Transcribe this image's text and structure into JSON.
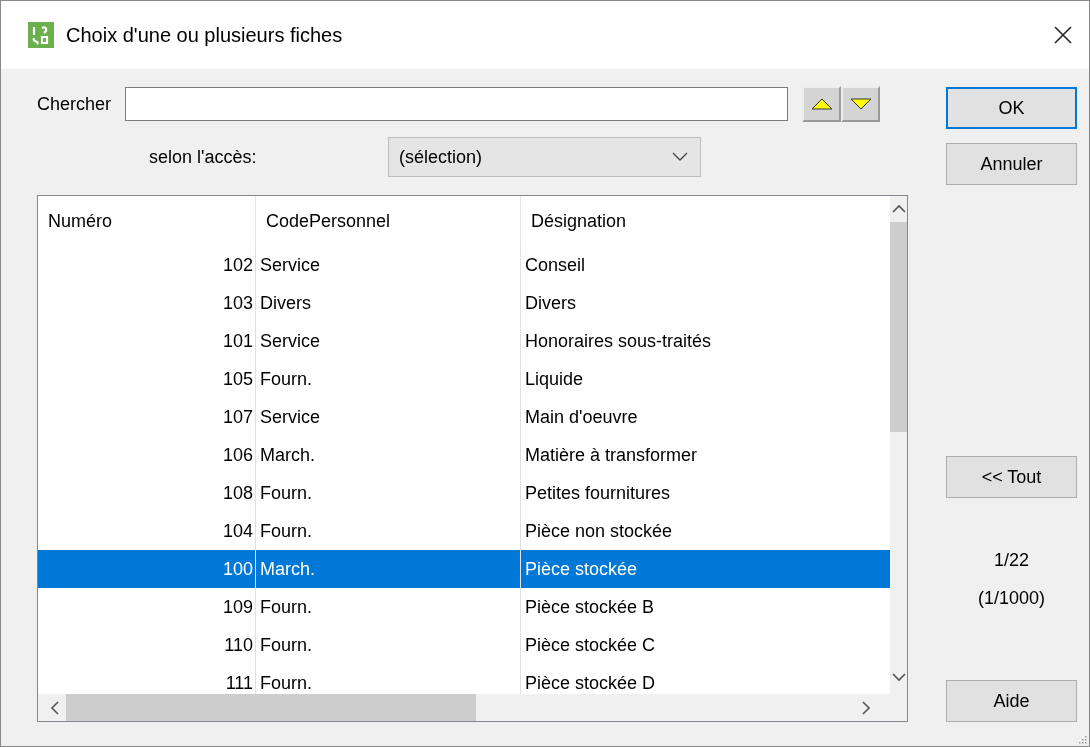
{
  "window": {
    "title": "Choix d'une ou plusieurs fiches"
  },
  "search": {
    "label": "Chercher"
  },
  "access": {
    "label": "selon l'accès:",
    "value": "(sélection)"
  },
  "table": {
    "columns": [
      "Numéro",
      "CodePersonnel",
      "Désignation"
    ],
    "rows": [
      {
        "cells": [
          "102",
          "Service",
          "Conseil"
        ],
        "selected": false
      },
      {
        "cells": [
          "103",
          "Divers",
          "Divers"
        ],
        "selected": false
      },
      {
        "cells": [
          "101",
          "Service",
          "Honoraires sous-traités"
        ],
        "selected": false
      },
      {
        "cells": [
          "105",
          "Fourn.",
          "Liquide"
        ],
        "selected": false
      },
      {
        "cells": [
          "107",
          "Service",
          "Main d'oeuvre"
        ],
        "selected": false
      },
      {
        "cells": [
          "106",
          "March.",
          "Matière à transformer"
        ],
        "selected": false
      },
      {
        "cells": [
          "108",
          "Fourn.",
          "Petites fournitures"
        ],
        "selected": false
      },
      {
        "cells": [
          "104",
          "Fourn.",
          "Pièce non stockée"
        ],
        "selected": false
      },
      {
        "cells": [
          "100",
          "March.",
          "Pièce stockée"
        ],
        "selected": true
      },
      {
        "cells": [
          "109",
          "Fourn.",
          "Pièce stockée B"
        ],
        "selected": false
      },
      {
        "cells": [
          "110",
          "Fourn.",
          "Pièce stockée C"
        ],
        "selected": false
      },
      {
        "cells": [
          "111",
          "Fourn.",
          "Pièce stockée D"
        ],
        "selected": false
      }
    ]
  },
  "actions": {
    "ok": "OK",
    "cancel": "Annuler",
    "all": "<< Tout",
    "help": "Aide"
  },
  "counter": {
    "current": "1/22",
    "total": "(1/1000)"
  }
}
